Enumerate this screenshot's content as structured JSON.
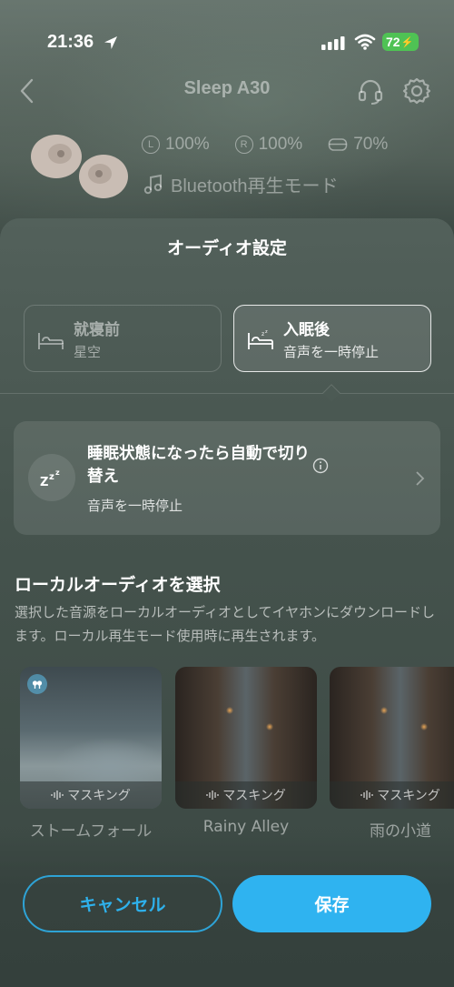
{
  "status_bar": {
    "time": "21:36",
    "battery": "72"
  },
  "header": {
    "title": "Sleep A30"
  },
  "device": {
    "left_battery": "100%",
    "right_battery": "100%",
    "case_battery": "70%",
    "left_label": "L",
    "right_label": "R",
    "mode": "Bluetooth再生モード"
  },
  "sheet": {
    "title": "オーディオ設定",
    "phases": [
      {
        "title": "就寝前",
        "subtitle": "星空",
        "selected": false
      },
      {
        "title": "入眠後",
        "subtitle": "音声を一時停止",
        "selected": true
      }
    ],
    "auto_switch": {
      "title": "睡眠状態になったら自動で切り替え",
      "subtitle": "音声を一時停止"
    },
    "local_audio": {
      "title": "ローカルオーディオを選択",
      "description": "選択した音源をローカルオーディオとしてイヤホンにダウンロードします。ローカル再生モード使用時に再生されます。",
      "items": [
        {
          "name": "ストームフォール",
          "tag": "マスキング"
        },
        {
          "name": "Rainy Alley",
          "tag": "マスキング"
        },
        {
          "name": "雨の小道",
          "tag": "マスキング"
        }
      ]
    }
  },
  "buttons": {
    "cancel": "キャンセル",
    "save": "保存"
  },
  "colors": {
    "accent": "#2fb3f0",
    "battery_green": "#4fc254"
  }
}
